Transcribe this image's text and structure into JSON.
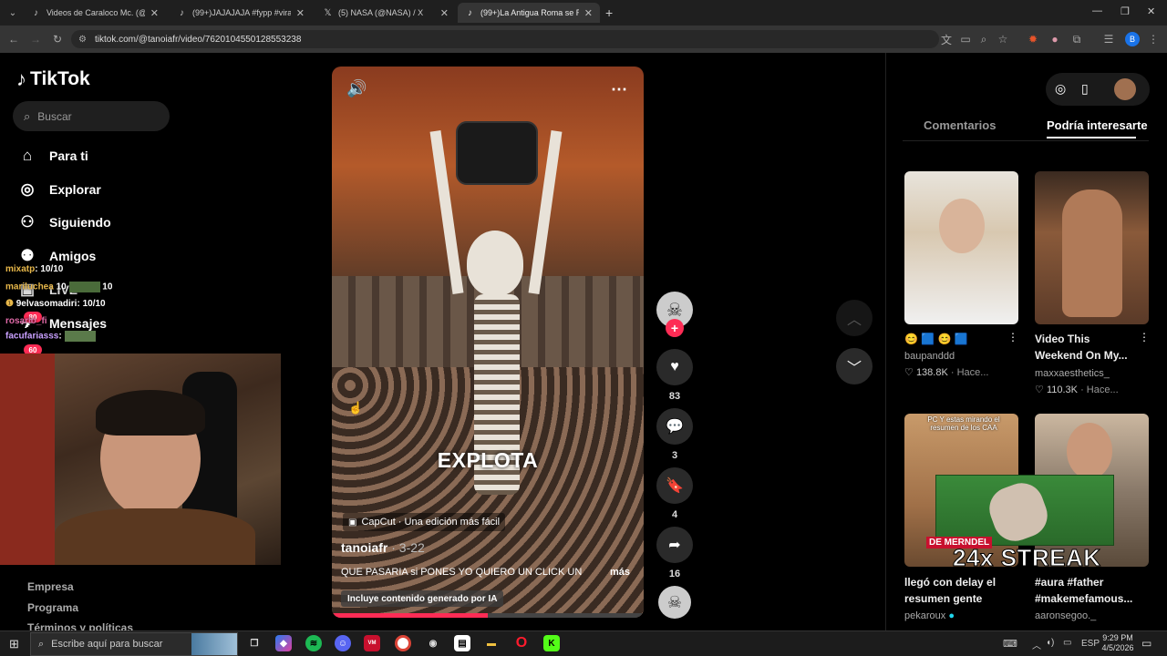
{
  "browser": {
    "tabs": [
      {
        "label": "Videos de Caraloco Mc. (@cara",
        "icon": "tiktok-icon"
      },
      {
        "label": "(99+)JAJAJAJA #fypp #viral #p",
        "icon": "tiktok-icon"
      },
      {
        "label": "(5) NASA (@NASA) / X",
        "icon": "x-icon"
      },
      {
        "label": "(99+)La Antigua Roma se Rinde",
        "icon": "tiktok-icon"
      }
    ],
    "url": "tiktok.com/@tanoiafr/video/7620104550128553238",
    "profile_initial": "B"
  },
  "sidebar": {
    "logo": "TikTok",
    "search_placeholder": "Buscar",
    "items": [
      {
        "label": "Para ti",
        "icon": "home-icon"
      },
      {
        "label": "Explorar",
        "icon": "compass-icon"
      },
      {
        "label": "Siguiendo",
        "icon": "following-icon"
      },
      {
        "label": "Amigos",
        "icon": "friends-icon"
      },
      {
        "label": "LIVE",
        "icon": "live-icon"
      },
      {
        "label": "Mensajes",
        "icon": "messages-icon"
      }
    ],
    "badges": [
      "80",
      "60"
    ],
    "footer": [
      "Empresa",
      "Programa",
      "Términos y políticas"
    ]
  },
  "chat": [
    {
      "user": "mixatp",
      "text": ": 10/10",
      "color": "#e8b84a"
    },
    {
      "user": "mariluchea",
      "text": "10",
      "extra": "10",
      "color": "#e8b84a"
    },
    {
      "user": "9elvasomadiri",
      "text": ": 10/10",
      "color": "#ffffff"
    },
    {
      "user": "rosario_fi",
      "text": "",
      "color": "#e06aa8"
    },
    {
      "user": "facufariasss",
      "text": ":",
      "color": "#c9a0ff"
    }
  ],
  "video": {
    "overlay_text": "EXPLOTA",
    "capcut": "CapCut · Una edición más fácil",
    "author": "tanoiafr",
    "date": "· 3-22",
    "caption": "QUE PASARIA si PONES YO QUIERO UN CLICK UN",
    "more": "más",
    "ai_label": "Incluye contenido generado por IA",
    "progress": 0.5
  },
  "actions": {
    "likes": "83",
    "comments": "3",
    "saves": "4",
    "shares": "16"
  },
  "right_panel": {
    "tabs": [
      "Comentarios",
      "Podría interesarte"
    ],
    "active_tab": 1,
    "cards": [
      {
        "title": "😊 🟦 😊 🟦",
        "author": "baupanddd",
        "likes": "138.8K",
        "time": "Hace..."
      },
      {
        "title": "Video This Weekend On My...",
        "author": "maxxaesthetics_",
        "likes": "110.3K",
        "time": "Hace..."
      },
      {
        "title": "llegó con delay el resumen gente",
        "author": "pekaroux",
        "overlay": "PC Y estas mirando el resumen de los CAA"
      },
      {
        "title": "#aura #father #makemefamous...",
        "author": "aaronsegoo._"
      }
    ],
    "streak": "24x STREAK",
    "streak_sub": "DE MERNDEL"
  },
  "taskbar": {
    "search_placeholder": "Escribe aquí para buscar",
    "lang": "ESP",
    "time": "9:29 PM",
    "date": "4/5/2026"
  }
}
